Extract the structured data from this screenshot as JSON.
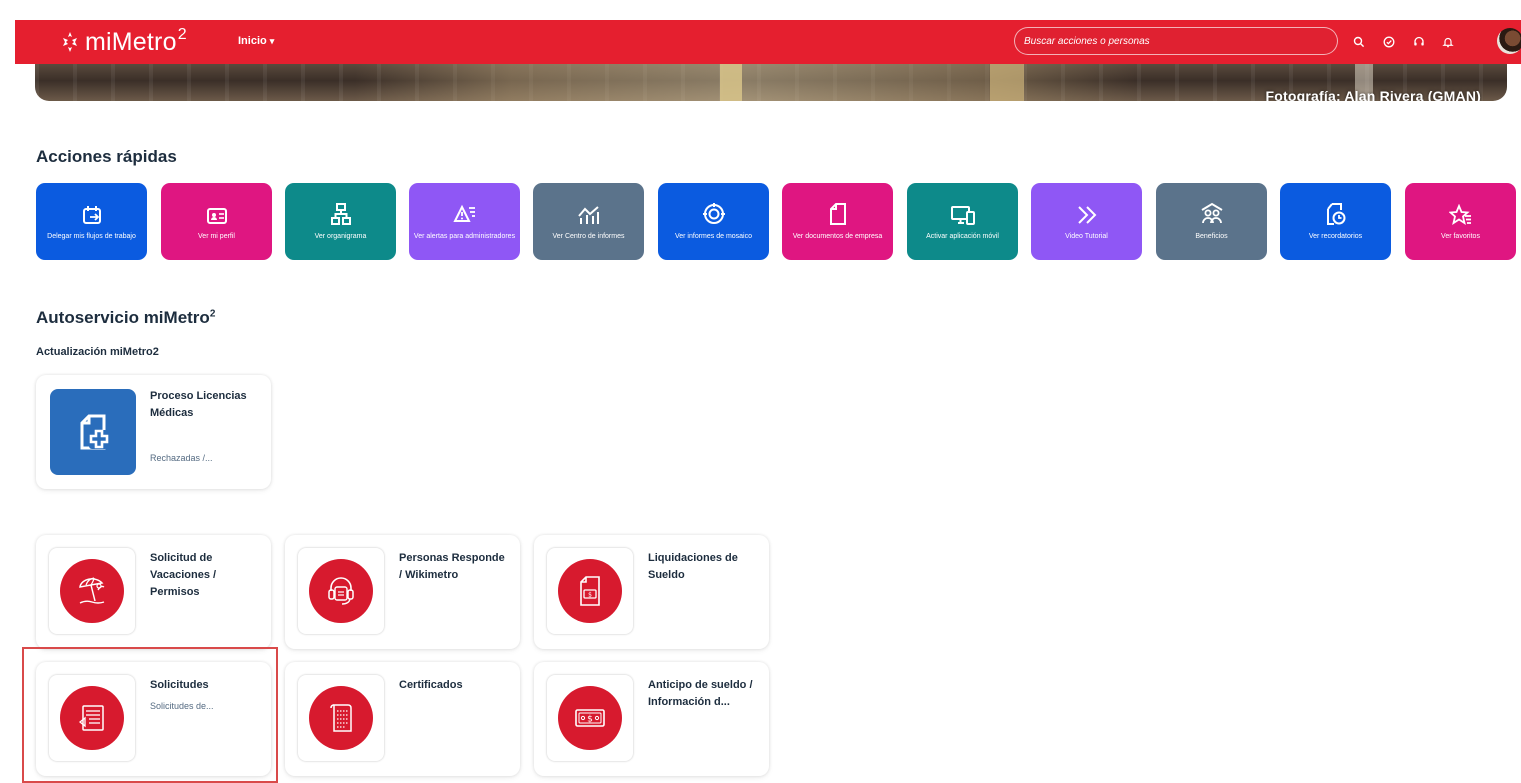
{
  "header": {
    "logo_text": "miMetro",
    "logo_sup": "2",
    "nav_label": "Inicio",
    "search_placeholder": "Buscar acciones o personas",
    "icons": [
      "search-icon",
      "check-circle-icon",
      "headset-icon",
      "bell-icon",
      "avatar"
    ],
    "brand_color": "#e51f2f"
  },
  "banner": {
    "credit": "Fotografía: Alan Rivera (GMAN)"
  },
  "quick_actions": {
    "title": "Acciones rápidas",
    "items": [
      {
        "label": "Delegar mis flujos de trabajo",
        "icon": "calendar-delegate-icon",
        "color": "#0b5be0"
      },
      {
        "label": "Ver mi perfil",
        "icon": "id-card-icon",
        "color": "#df1681"
      },
      {
        "label": "Ver organigrama",
        "icon": "org-chart-icon",
        "color": "#0d8a8a"
      },
      {
        "label": "Ver alertas para administradores",
        "icon": "alert-list-icon",
        "color": "#8f57f5"
      },
      {
        "label": "Ver Centro de informes",
        "icon": "chart-icon",
        "color": "#5b738b"
      },
      {
        "label": "Ver informes de mosaico",
        "icon": "target-icon",
        "color": "#0b5be0"
      },
      {
        "label": "Ver documentos de empresa",
        "icon": "document-icon",
        "color": "#df1681"
      },
      {
        "label": "Activar aplicación móvil",
        "icon": "devices-icon",
        "color": "#0d8a8a"
      },
      {
        "label": "Video Tutorial",
        "icon": "fast-forward-icon",
        "color": "#8f57f5"
      },
      {
        "label": "Beneficios",
        "icon": "people-group-icon",
        "color": "#5b738b"
      },
      {
        "label": "Ver recordatorios",
        "icon": "reminder-icon",
        "color": "#0b5be0"
      },
      {
        "label": "Ver favoritos",
        "icon": "star-list-icon",
        "color": "#df1681"
      }
    ]
  },
  "self_service": {
    "title": "Autoservicio miMetro",
    "title_sup": "2",
    "group_label": "Actualización miMetro2",
    "medical": {
      "title": "Proceso Licencias Médicas",
      "subtitle": "Rechazadas /...",
      "icon": "medical-document-icon",
      "color": "#2a6dbb"
    },
    "tiles": [
      {
        "title": "Solicitud de Vacaciones / Permisos",
        "subtitle": "",
        "icon": "beach-umbrella-icon"
      },
      {
        "title": "Personas Responde / Wikimetro",
        "subtitle": "",
        "icon": "support-headset-icon"
      },
      {
        "title": "Liquidaciones de Sueldo",
        "subtitle": "",
        "icon": "payslip-icon"
      },
      {
        "title": "Solicitudes",
        "subtitle": "Solicitudes de...",
        "icon": "request-form-icon"
      },
      {
        "title": "Certificados",
        "subtitle": "",
        "icon": "certificate-icon"
      },
      {
        "title": "Anticipo de sueldo / Información d...",
        "subtitle": "",
        "icon": "money-bill-icon"
      }
    ],
    "accent_color": "#d71a2e"
  }
}
